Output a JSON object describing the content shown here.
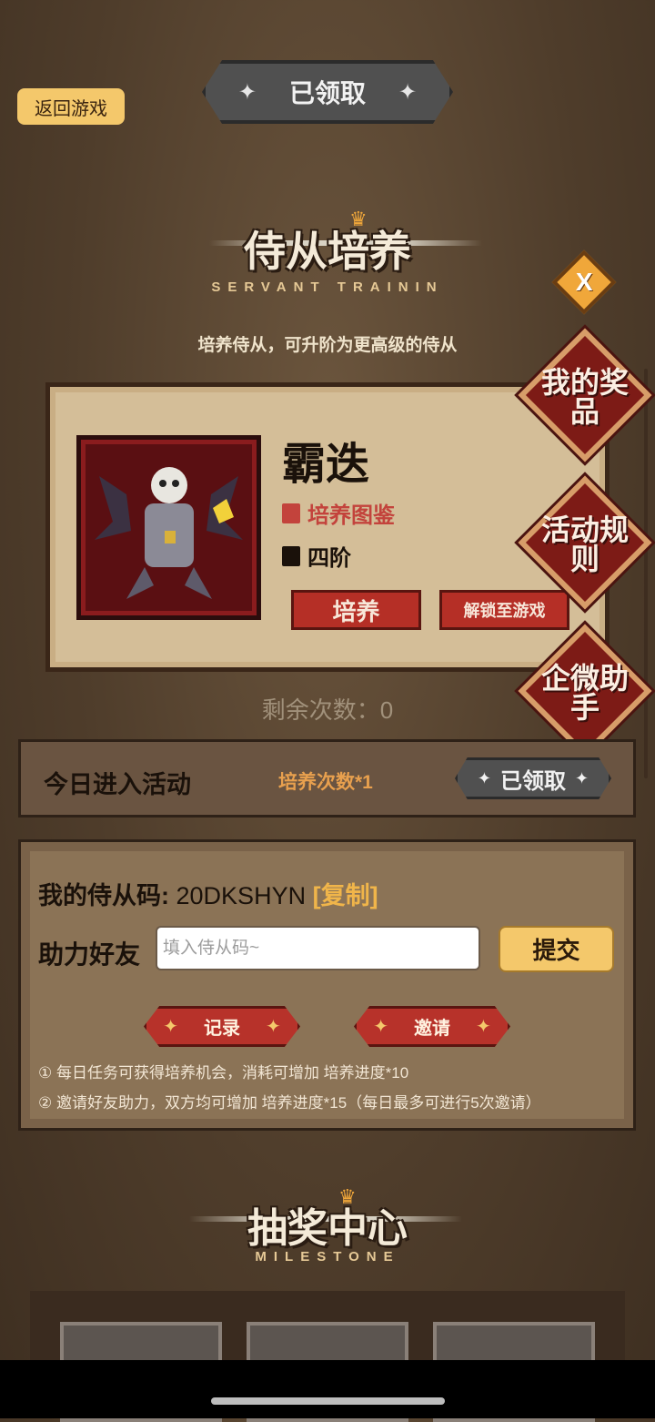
{
  "header": {
    "claimed_label": "已领取",
    "back_label": "返回游戏"
  },
  "training": {
    "title": "侍从培养",
    "subtitle": "SERVANT TRAININ",
    "desc": "培养侍从，可升阶为更高级的侍从",
    "servant_name": "霸迭",
    "codex_label": "培养图鉴",
    "tier_label": "四阶",
    "train_button": "培养",
    "unlock_button": "解锁至游戏"
  },
  "side": {
    "close": "X",
    "prizes": "我的奖品",
    "rules": "活动规则",
    "assistant": "企微助手"
  },
  "remaining": {
    "label": "剩余次数：",
    "value": "0"
  },
  "daily": {
    "label": "今日进入活动",
    "reward": "培养次数*1",
    "claimed": "已领取"
  },
  "invite": {
    "code_label": "我的侍从码:",
    "code_value": "20DKSHYN",
    "copy_label": "[复制]",
    "help_label": "助力好友",
    "input_placeholder": "填入侍从码~",
    "submit_label": "提交",
    "record_label": "记录",
    "invite_label": "邀请",
    "note1": "① 每日任务可获得培养机会，消耗可增加 培养进度*10",
    "note2": "② 邀请好友助力，双方均可增加 培养进度*15（每日最多可进行5次邀请）"
  },
  "lottery": {
    "title": "抽奖中心",
    "subtitle": "MILESTONE"
  },
  "colors": {
    "accent": "#f4c86b",
    "red": "#b52f26",
    "orange_text": "#e8a04e"
  }
}
